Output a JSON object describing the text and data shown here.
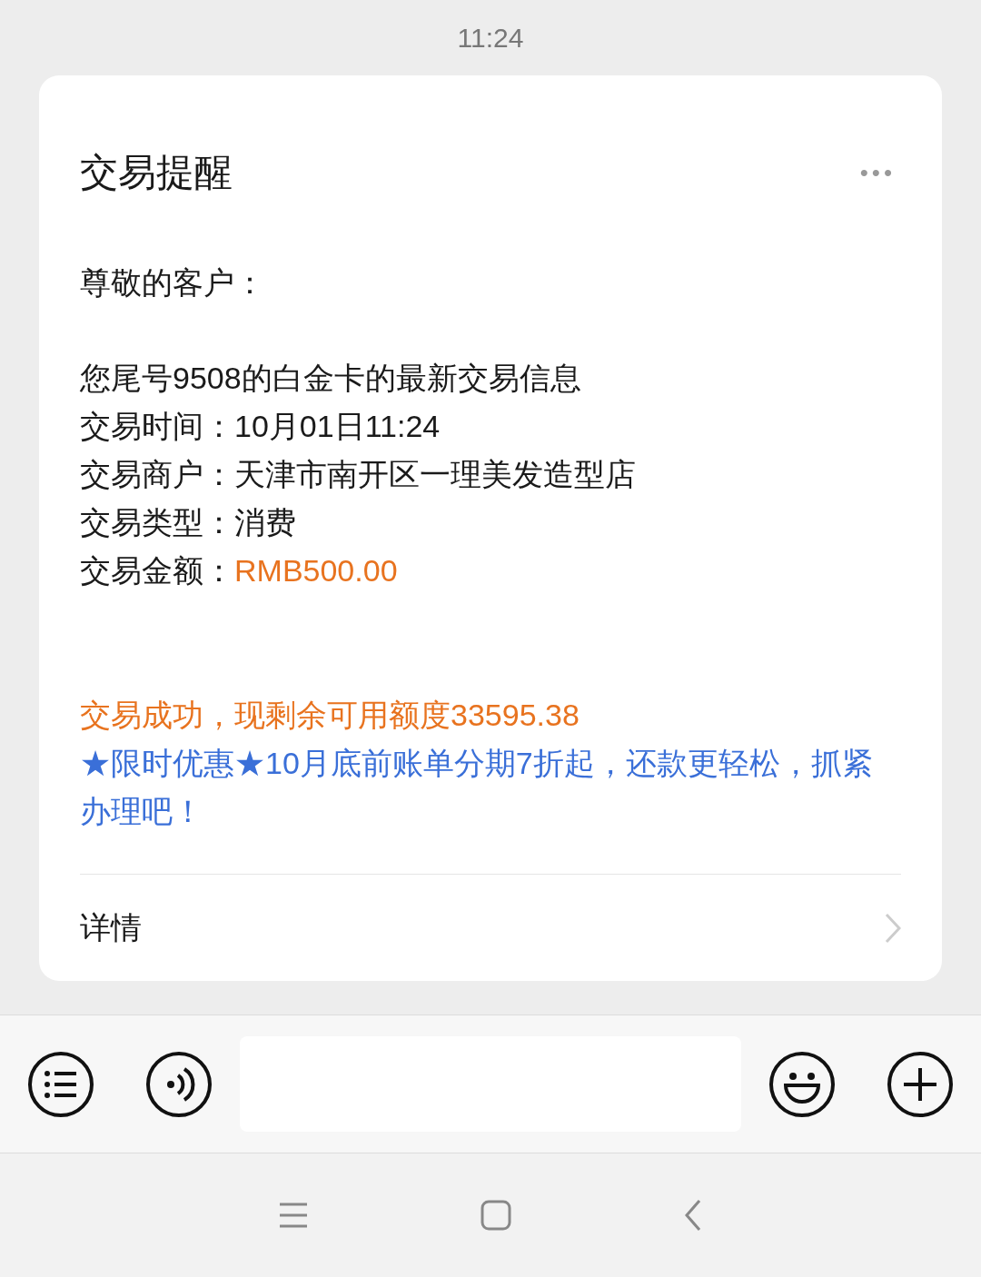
{
  "status_bar": {
    "time": "11:24"
  },
  "card": {
    "title": "交易提醒",
    "more": "•••",
    "greeting": "尊敬的客户：",
    "intro": "您尾号9508的白金卡的最新交易信息",
    "fields": [
      {
        "label": "交易时间：",
        "value": "10月01日11:24",
        "kind": "plain"
      },
      {
        "label": "交易商户：",
        "value": "天津市南开区一理美发造型店",
        "kind": "plain"
      },
      {
        "label": "交易类型：",
        "value": "消费",
        "kind": "plain"
      },
      {
        "label": "交易金额：",
        "value": "RMB500.00",
        "kind": "amount"
      }
    ],
    "paragraphs": [
      {
        "kind": "notice",
        "text": "交易成功，现剩余可用额度33595.38"
      },
      {
        "kind": "promo",
        "text": "★限时优惠★10月底前账单分期7折起，还款更轻松，抓紧办理吧！"
      }
    ],
    "details_link": "详情"
  }
}
